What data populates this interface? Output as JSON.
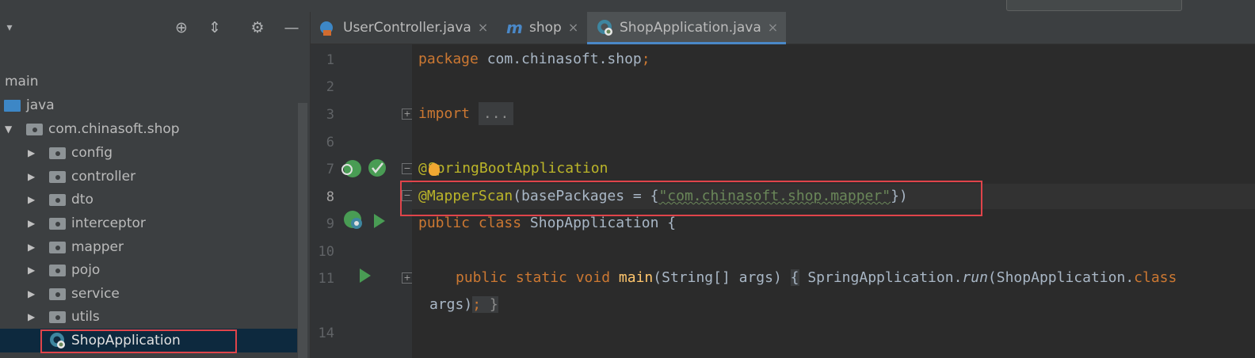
{
  "project_panel": {
    "header_icons": [
      "collapse-arrow-icon",
      "locate-icon",
      "collapse-all-icon",
      "settings-icon",
      "hide-icon"
    ],
    "tree": [
      {
        "label": "main",
        "indent": 0,
        "kind": "text"
      },
      {
        "label": "java",
        "indent": 0,
        "kind": "source-folder"
      },
      {
        "label": "com.chinasoft.shop",
        "indent": 1,
        "kind": "package",
        "expanded": true
      },
      {
        "label": "config",
        "indent": 2,
        "kind": "package"
      },
      {
        "label": "controller",
        "indent": 2,
        "kind": "package"
      },
      {
        "label": "dto",
        "indent": 2,
        "kind": "package"
      },
      {
        "label": "interceptor",
        "indent": 2,
        "kind": "package"
      },
      {
        "label": "mapper",
        "indent": 2,
        "kind": "package"
      },
      {
        "label": "pojo",
        "indent": 2,
        "kind": "package"
      },
      {
        "label": "service",
        "indent": 2,
        "kind": "package"
      },
      {
        "label": "utils",
        "indent": 2,
        "kind": "package"
      },
      {
        "label": "ShopApplication",
        "indent": 2,
        "kind": "spring-class",
        "selected": true
      }
    ]
  },
  "tabs": [
    {
      "label": "UserController.java",
      "icon": "java-class-icon",
      "close": "×"
    },
    {
      "label": "shop",
      "icon": "maven-icon",
      "close": "×"
    },
    {
      "label": "ShopApplication.java",
      "icon": "spring-boot-icon",
      "close": "×",
      "active": true
    }
  ],
  "editor": {
    "line_numbers": [
      "1",
      "2",
      "3",
      "6",
      "7",
      "8",
      "9",
      "10",
      "11",
      "14"
    ],
    "code": {
      "l1_kw": "package ",
      "l1_rest": "com.chinasoft.shop",
      "l1_semi": ";",
      "l3_kw": "import ",
      "l3_fold": "...",
      "l7_at": "@",
      "l7_ann": "SpringBootApplication",
      "l8_ann": "@MapperScan",
      "l8_mid": "(basePackages = {",
      "l8_str": "\"com.chinasoft.shop.mapper\"",
      "l8_end": "})",
      "l9_kw": "public class ",
      "l9_rest": "ShopApplication {",
      "l11_kw": "public static void ",
      "l11_method": "main",
      "l11_params": "(String[] args) ",
      "l11_brace": "{",
      "l11_call": " SpringApplication.",
      "l11_run": "run",
      "l11_tail": "(ShopApplication.",
      "l11_class": "class",
      "l12_args": "args)",
      "l12_semi": ";",
      "l12_brace": " }"
    }
  },
  "colors": {
    "keyword": "#cc7832",
    "annotation": "#bbb529",
    "string": "#6a8759",
    "highlight_box": "#e0444a"
  }
}
